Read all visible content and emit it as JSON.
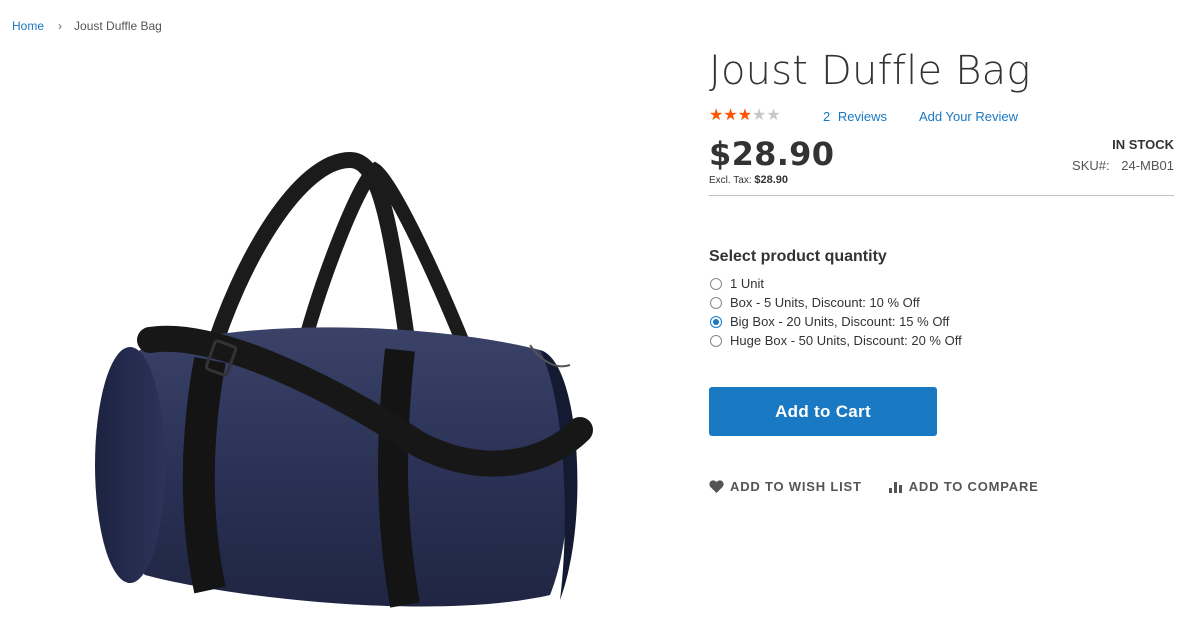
{
  "breadcrumb": {
    "home": "Home",
    "separator": "›",
    "current": "Joust Duffle Bag"
  },
  "product": {
    "title": "Joust Duffle Bag",
    "rating_fraction": 0.5,
    "star_glyphs": "★★★★★",
    "reviews_count": "2",
    "reviews_label": "Reviews",
    "add_review": "Add Your Review",
    "price": "$28.90",
    "excl_tax_label": "Excl. Tax:",
    "excl_tax_value": "$28.90",
    "stock": "In stock",
    "sku_label": "SKU#:",
    "sku_value": "24-MB01",
    "image_icon": "duffle-bag-image"
  },
  "quantity": {
    "title": "Select product quantity",
    "options": [
      {
        "label": "1 Unit",
        "checked": false
      },
      {
        "label": "Box - 5 Units, Discount: 10 % Off",
        "checked": false
      },
      {
        "label": "Big Box - 20 Units, Discount: 15 % Off",
        "checked": true
      },
      {
        "label": "Huge Box - 50 Units, Discount: 20 % Off",
        "checked": false
      }
    ]
  },
  "actions": {
    "add_to_cart": "Add to Cart",
    "wishlist": "Add to Wish List",
    "compare": "Add to Compare",
    "wishlist_icon": "heart-icon",
    "compare_icon": "bar-chart-icon"
  },
  "colors": {
    "accent": "#1979c3",
    "star_active": "#ff5501",
    "star_inactive": "#c7c7c7",
    "bag_body": "#2a3152",
    "strap": "#1a1a1a"
  }
}
